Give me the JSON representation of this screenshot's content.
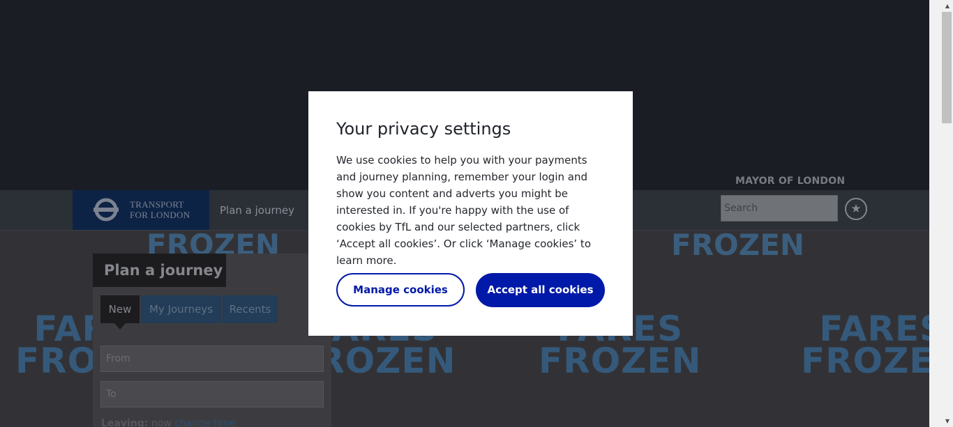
{
  "header": {
    "logo_line1": "TRANSPORT",
    "logo_line2": "FOR LONDON",
    "nav_plan": "Plan a journey",
    "mayor": "MAYOR OF LONDON",
    "search_placeholder": "Search",
    "star_icon": "★"
  },
  "promo": {
    "line1": "FARES",
    "line2": "FROZEN",
    "top_word": "FROZEN"
  },
  "planner": {
    "title": "Plan a journey",
    "tabs": [
      "New",
      "My Journeys",
      "Recents"
    ],
    "from_placeholder": "From",
    "to_placeholder": "To",
    "leaving_label": "Leaving:",
    "leaving_value": "now",
    "change_time": "change time"
  },
  "modal": {
    "title": "Your privacy settings",
    "body": "We use cookies to help you with your payments and journey planning, remember your login and show you content and adverts you might be interested in. If you're happy with the use of cookies by TfL and our selected partners, click ‘Accept all cookies’. Or click ‘Manage cookies’ to learn more.",
    "manage_label": "Manage cookies",
    "accept_label": "Accept all cookies"
  },
  "colors": {
    "accent": "#0019a8",
    "modal_bg": "#ffffff",
    "overlay": "#14171e"
  },
  "scrollbar": {
    "up_arrow": "▲",
    "down_arrow": "▼"
  }
}
